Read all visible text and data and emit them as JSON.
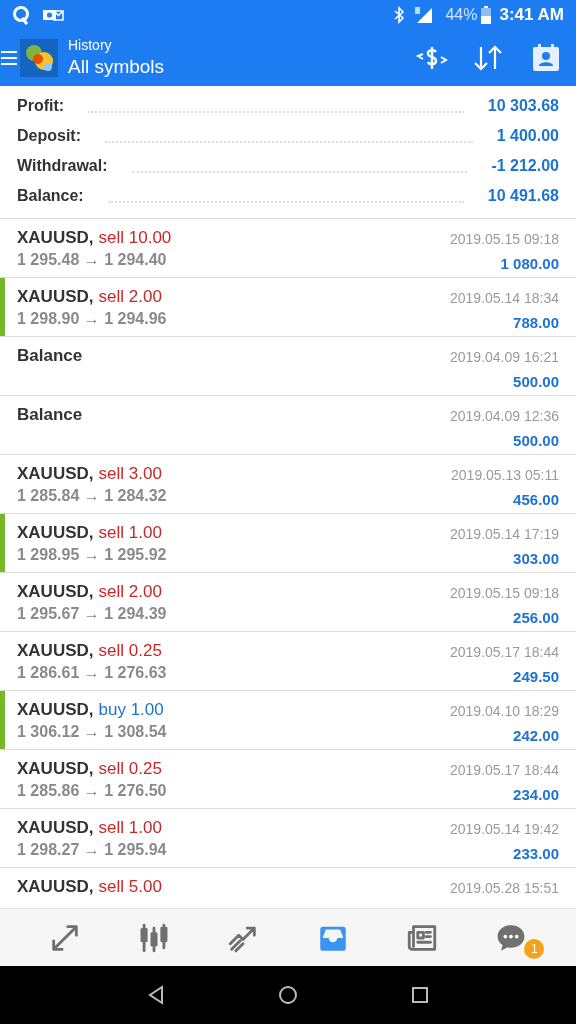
{
  "status_bar": {
    "battery": "44%",
    "time": "3:41 AM"
  },
  "toolbar": {
    "title": "History",
    "subtitle": "All symbols"
  },
  "summary": [
    {
      "label": "Profit:",
      "value": "10 303.68"
    },
    {
      "label": "Deposit:",
      "value": "1 400.00"
    },
    {
      "label": "Withdrawal:",
      "value": "-1 212.00"
    },
    {
      "label": "Balance:",
      "value": "10 491.68"
    }
  ],
  "rows": [
    {
      "kind": "trade",
      "symbol": "XAUUSD,",
      "order": "sell 10.00",
      "color": "#c62828",
      "prices": "1 295.48 → 1 294.40",
      "time": "2019.05.15 09:18",
      "profit": "1 080.00",
      "marked": false
    },
    {
      "kind": "trade",
      "symbol": "XAUUSD,",
      "order": "sell 2.00",
      "color": "#c62828",
      "prices": "1 298.90 → 1 294.96",
      "time": "2019.05.14 18:34",
      "profit": "788.00",
      "marked": true
    },
    {
      "kind": "balance",
      "symbol": "Balance",
      "time": "2019.04.09 16:21",
      "profit": "500.00",
      "marked": false
    },
    {
      "kind": "balance",
      "symbol": "Balance",
      "time": "2019.04.09 12:36",
      "profit": "500.00",
      "marked": false
    },
    {
      "kind": "trade",
      "symbol": "XAUUSD,",
      "order": "sell 3.00",
      "color": "#c62828",
      "prices": "1 285.84 → 1 284.32",
      "time": "2019.05.13 05:11",
      "profit": "456.00",
      "marked": false
    },
    {
      "kind": "trade",
      "symbol": "XAUUSD,",
      "order": "sell 1.00",
      "color": "#c62828",
      "prices": "1 298.95 → 1 295.92",
      "time": "2019.05.14 17:19",
      "profit": "303.00",
      "marked": true
    },
    {
      "kind": "trade",
      "symbol": "XAUUSD,",
      "order": "sell 2.00",
      "color": "#c62828",
      "prices": "1 295.67 → 1 294.39",
      "time": "2019.05.15 09:18",
      "profit": "256.00",
      "marked": false
    },
    {
      "kind": "trade",
      "symbol": "XAUUSD,",
      "order": "sell 0.25",
      "color": "#c62828",
      "prices": "1 286.61 → 1 276.63",
      "time": "2019.05.17 18:44",
      "profit": "249.50",
      "marked": false
    },
    {
      "kind": "trade",
      "symbol": "XAUUSD,",
      "order": "buy 1.00",
      "color": "#1e73d2",
      "prices": "1 306.12 → 1 308.54",
      "time": "2019.04.10 18:29",
      "profit": "242.00",
      "marked": true
    },
    {
      "kind": "trade",
      "symbol": "XAUUSD,",
      "order": "sell 0.25",
      "color": "#c62828",
      "prices": "1 285.86 → 1 276.50",
      "time": "2019.05.17 18:44",
      "profit": "234.00",
      "marked": false
    },
    {
      "kind": "trade",
      "symbol": "XAUUSD,",
      "order": "sell 1.00",
      "color": "#c62828",
      "prices": "1 298.27 → 1 295.94",
      "time": "2019.05.14 19:42",
      "profit": "233.00",
      "marked": false
    },
    {
      "kind": "trade",
      "symbol": "XAUUSD,",
      "order": "sell 5.00",
      "color": "#c62828",
      "time": "2019.05.28 15:51",
      "marked": false
    }
  ],
  "bottom_nav": [
    {
      "kind": "trade",
      "selected": false
    },
    {
      "kind": "quotes",
      "selected": false
    },
    {
      "kind": "chart",
      "selected": false
    },
    {
      "kind": "history",
      "selected": true
    },
    {
      "kind": "news",
      "selected": false
    },
    {
      "kind": "chat",
      "selected": false,
      "badge": "1"
    }
  ]
}
